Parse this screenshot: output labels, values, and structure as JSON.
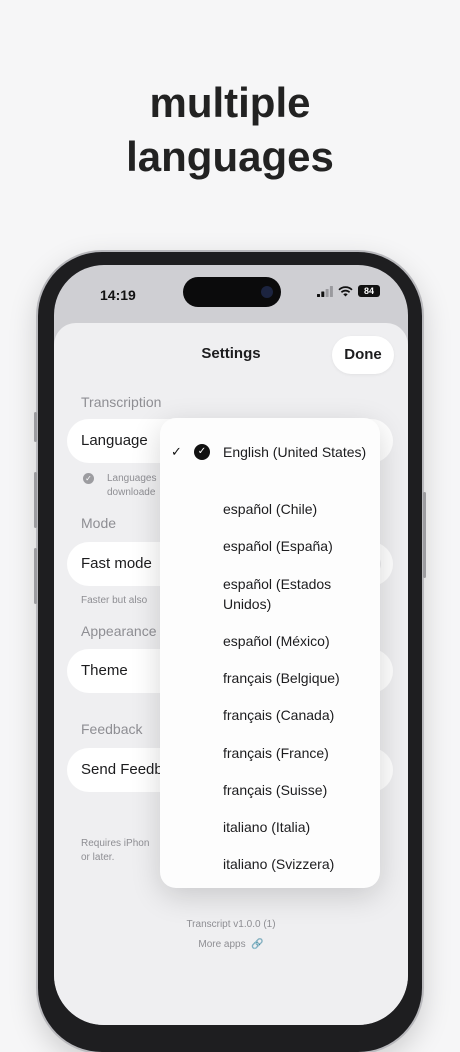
{
  "headline": [
    "multiple",
    "languages"
  ],
  "status_bar": {
    "time": "14:19",
    "battery": "84"
  },
  "sheet": {
    "title": "Settings",
    "done_label": "Done",
    "sections": {
      "transcription": "Transcription",
      "mode": "Mode",
      "appearance": "Appearance",
      "feedback": "Feedback"
    },
    "rows": {
      "language": "Language",
      "fast_mode": "Fast mode",
      "theme": "Theme",
      "send_feedback": "Send Feedback"
    },
    "notes": {
      "languages": "Languages",
      "downloaded": "downloade",
      "fast_mode": "Faster but also",
      "requires_1": "Requires iPhon",
      "requires_2": "or later."
    },
    "footer": {
      "version": "Transcript v1.0.0 (1)",
      "more_apps": "More apps"
    }
  },
  "language_menu": {
    "selected_index": 0,
    "items": [
      "English (United States)",
      "español (Chile)",
      "español (España)",
      "español (Estados Unidos)",
      "español (México)",
      "français (Belgique)",
      "français (Canada)",
      "français (France)",
      "français (Suisse)",
      "italiano (Italia)",
      "italiano (Svizzera)"
    ]
  }
}
